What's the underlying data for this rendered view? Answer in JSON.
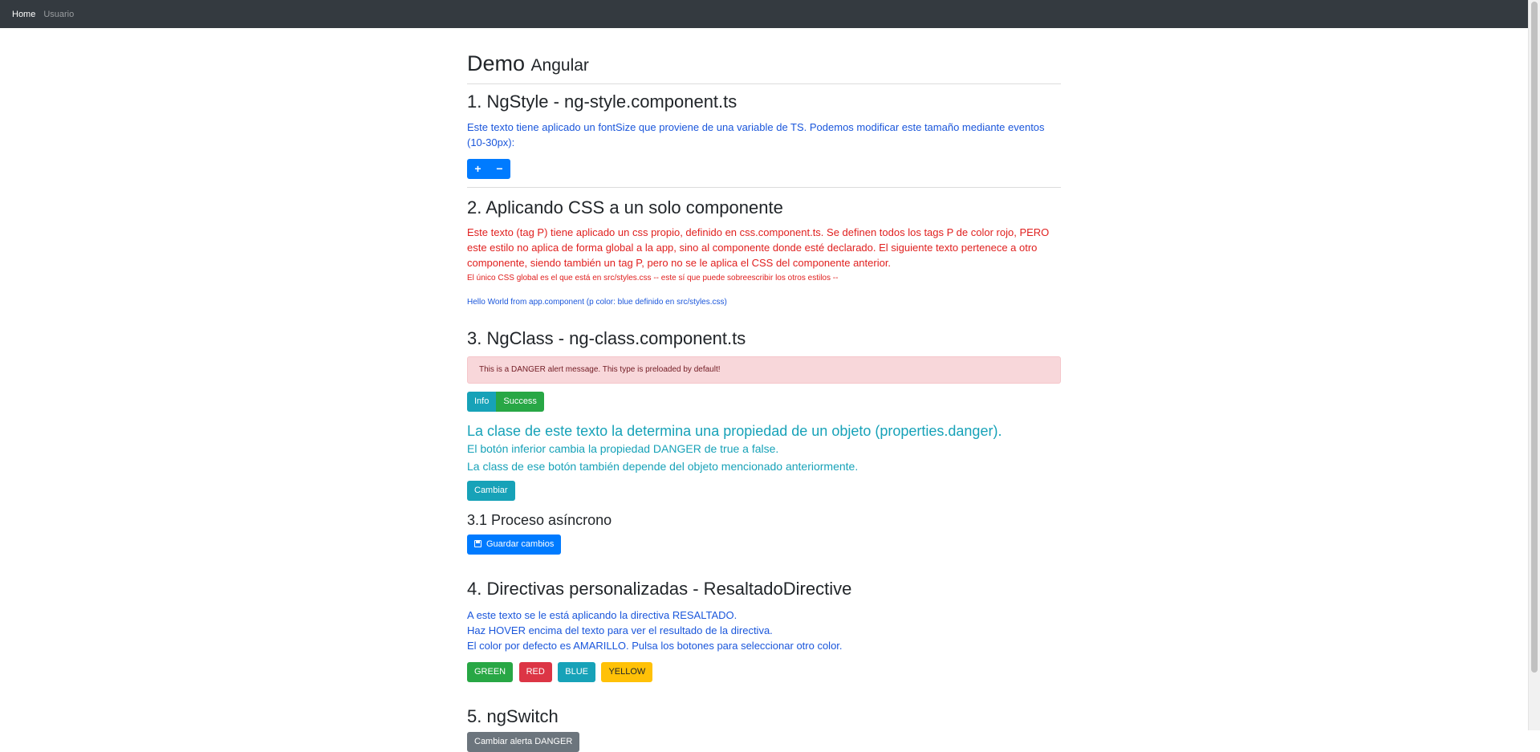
{
  "navbar": {
    "home": "Home",
    "usuario": "Usuario"
  },
  "page": {
    "title_main": "Demo",
    "title_small": "Angular"
  },
  "section1": {
    "heading": "1. NgStyle - ng-style.component.ts",
    "text": "Este texto tiene aplicado un fontSize que proviene de una variable de TS. Podemos modificar este tamaño mediante eventos (10-30px):",
    "plus_label": "+",
    "minus_label": "−"
  },
  "section2": {
    "heading": "2. Aplicando CSS a un solo componente",
    "text": "Este texto (tag P) tiene aplicado un css propio, definido en css.component.ts. Se definen todos los tags P de color rojo, PERO este estilo no aplica de forma global a la app, sino al componente donde esté declarado. El siguiente texto pertenece a otro componente, siendo también un tag P, pero no se le aplica el CSS del componente anterior.",
    "small_note": "El único CSS global es el que está en src/styles.css -- este sí que puede sobreescribir los otros estilos --",
    "hello": "Hello World from app.component (p color: blue definido en src/styles.css)"
  },
  "section3": {
    "heading": "3. NgClass - ng-class.component.ts",
    "alert": "This is a DANGER alert message. This type is preloaded by default!",
    "info_label": "Info",
    "success_label": "Success",
    "class_title": "La clase de este texto la determina una propiedad de un objeto (properties.danger).",
    "class_line1": "El botón inferior cambia la propiedad DANGER de true a false.",
    "class_line2": "La class de ese botón también depende del objeto mencionado anteriormente.",
    "cambiar_label": "Cambiar"
  },
  "section31": {
    "heading": "3.1 Proceso asíncrono",
    "save_label": "Guardar cambios",
    "save_icon": "floppy-disk-icon"
  },
  "section4": {
    "heading": "4. Directivas personalizadas - ResaltadoDirective",
    "line1": "A este texto se le está aplicando la directiva RESALTADO.",
    "line2": "Haz HOVER encima del texto para ver el resultado de la directiva.",
    "line3": "El color por defecto es AMARILLO. Pulsa los botones para seleccionar otro color.",
    "green": "GREEN",
    "red": "RED",
    "blue": "BLUE",
    "yellow": "YELLOW"
  },
  "section5": {
    "heading": "5. ngSwitch",
    "button_label": "Cambiar alerta DANGER"
  },
  "colors": {
    "navbar": "#343a40",
    "primary": "#007bff",
    "info": "#17a2b8",
    "success": "#28a745",
    "danger": "#dc3545",
    "warning": "#ffc107"
  }
}
